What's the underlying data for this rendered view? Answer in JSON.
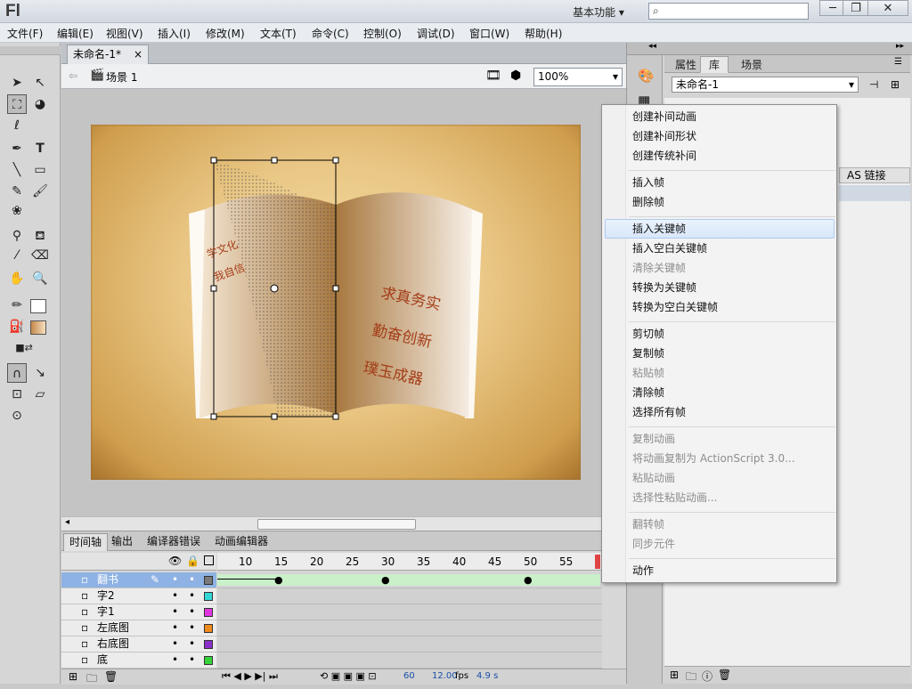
{
  "app": {
    "logo": "Fl",
    "workspace": "基本功能",
    "search_icon": "search-icon",
    "window_controls": [
      "─",
      "❐",
      "✕"
    ]
  },
  "menubar": [
    "文件(F)",
    "编辑(E)",
    "视图(V)",
    "插入(I)",
    "修改(M)",
    "文本(T)",
    "命令(C)",
    "控制(O)",
    "调试(D)",
    "窗口(W)",
    "帮助(H)"
  ],
  "document": {
    "tab_title": "未命名-1*",
    "tab_close": "×",
    "scene": "场景 1",
    "zoom": "100%"
  },
  "stage_text": {
    "left_page_1": "学文化",
    "left_page_2": "我自信",
    "right_page_1": "求真务实",
    "right_page_2": "勤奋创新",
    "right_page_3": "璞玉成器"
  },
  "timeline": {
    "tabs": [
      "时间轴",
      "输出",
      "编译器错误",
      "动画编辑器"
    ],
    "frame_numbers": [
      "10",
      "15",
      "20",
      "25",
      "30",
      "35",
      "40",
      "45",
      "50",
      "55"
    ],
    "layers": [
      {
        "name": "翻书",
        "color": "#7a7a7a",
        "selected": true
      },
      {
        "name": "字2",
        "color": "#33d7d7",
        "selected": false
      },
      {
        "name": "字1",
        "color": "#e036e0",
        "selected": false
      },
      {
        "name": "左底图",
        "color": "#f08a1c",
        "selected": false
      },
      {
        "name": "右底图",
        "color": "#8a2fc9",
        "selected": false
      },
      {
        "name": "底",
        "color": "#36d23a",
        "selected": false
      }
    ],
    "status": {
      "frame": "60",
      "fps": "12.00",
      "fps_unit": "fps",
      "time": "4.9 s"
    }
  },
  "right_panel": {
    "tabs": [
      "属性",
      "库",
      "场景"
    ],
    "active_tab": "库",
    "library_doc": "未命名-1",
    "as_link": "AS 链接"
  },
  "context_menu": {
    "groups": [
      [
        {
          "label": "创建补间动画",
          "enabled": true
        },
        {
          "label": "创建补间形状",
          "enabled": true
        },
        {
          "label": "创建传统补间",
          "enabled": true
        }
      ],
      [
        {
          "label": "插入帧",
          "enabled": true
        },
        {
          "label": "删除帧",
          "enabled": true
        }
      ],
      [
        {
          "label": "插入关键帧",
          "enabled": true,
          "highlighted": true
        },
        {
          "label": "插入空白关键帧",
          "enabled": true
        },
        {
          "label": "清除关键帧",
          "enabled": false
        },
        {
          "label": "转换为关键帧",
          "enabled": true
        },
        {
          "label": "转换为空白关键帧",
          "enabled": true
        }
      ],
      [
        {
          "label": "剪切帧",
          "enabled": true
        },
        {
          "label": "复制帧",
          "enabled": true
        },
        {
          "label": "粘贴帧",
          "enabled": false
        },
        {
          "label": "清除帧",
          "enabled": true
        },
        {
          "label": "选择所有帧",
          "enabled": true
        }
      ],
      [
        {
          "label": "复制动画",
          "enabled": false
        },
        {
          "label": "将动画复制为 ActionScript 3.0...",
          "enabled": false
        },
        {
          "label": "粘贴动画",
          "enabled": false
        },
        {
          "label": "选择性粘贴动画...",
          "enabled": false
        }
      ],
      [
        {
          "label": "翻转帧",
          "enabled": false
        },
        {
          "label": "同步元件",
          "enabled": false
        }
      ],
      [
        {
          "label": "动作",
          "enabled": true
        }
      ]
    ]
  }
}
